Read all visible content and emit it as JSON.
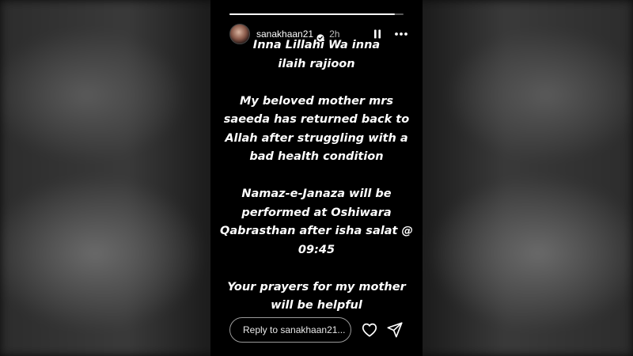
{
  "story": {
    "progress": 0.95,
    "header": {
      "username": "sanakhaan21",
      "verified": true,
      "time": "2h",
      "icons": [
        "pause-icon",
        "more-icon"
      ]
    },
    "message": {
      "line1": "Inna Lillahi Wa inna",
      "line2": "ilaih rajioon",
      "para2": "My beloved mother mrs saeeda has returned back to Allah after struggling with a bad health condition",
      "para3": "Namaz-e-Janaza will be performed at Oshiwara Qabrasthan after isha salat  @ 09:45",
      "para4": "Your prayers for my mother will be helpful"
    },
    "reply": {
      "placeholder": "Reply to sanakhaan21...",
      "icons": [
        "heart-icon",
        "send-icon"
      ]
    }
  }
}
